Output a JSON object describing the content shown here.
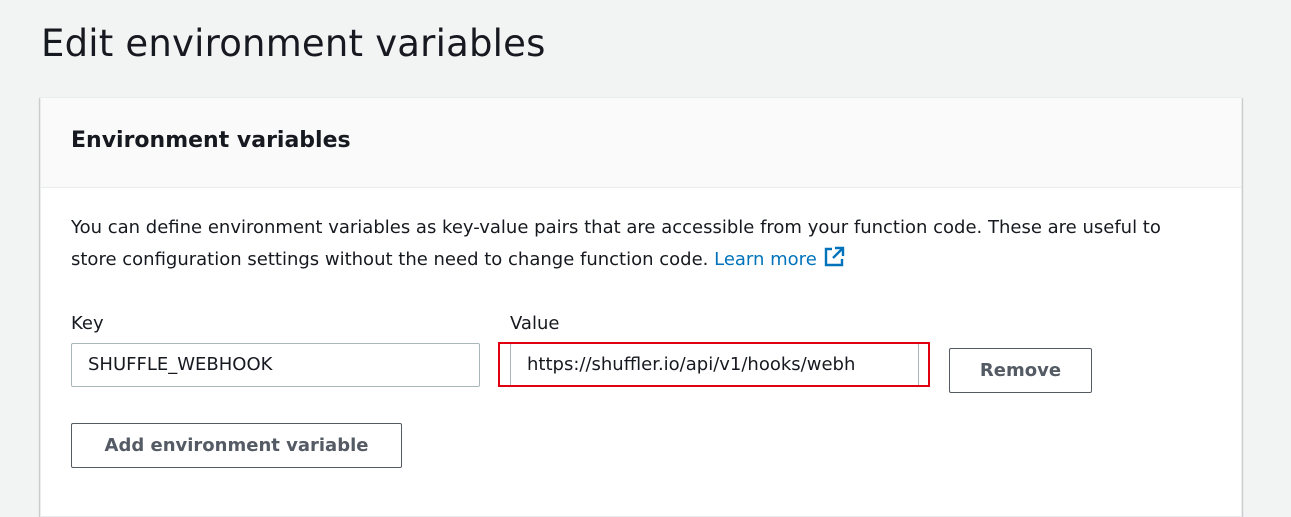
{
  "page": {
    "title": "Edit environment variables"
  },
  "panel": {
    "title": "Environment variables",
    "description": "You can define environment variables as key-value pairs that are accessible from your function code. These are useful to store configuration settings without the need to change function code.",
    "learn_more": "Learn more",
    "link_color": "#0073bb"
  },
  "variables": {
    "key_label": "Key",
    "value_label": "Value",
    "rows": [
      {
        "key": "SHUFFLE_WEBHOOK",
        "value": "https://shuffler.io/api/v1/hooks/webh"
      }
    ],
    "remove_label": "Remove",
    "add_label": "Add environment variable"
  },
  "highlight_color": "#e0000f"
}
